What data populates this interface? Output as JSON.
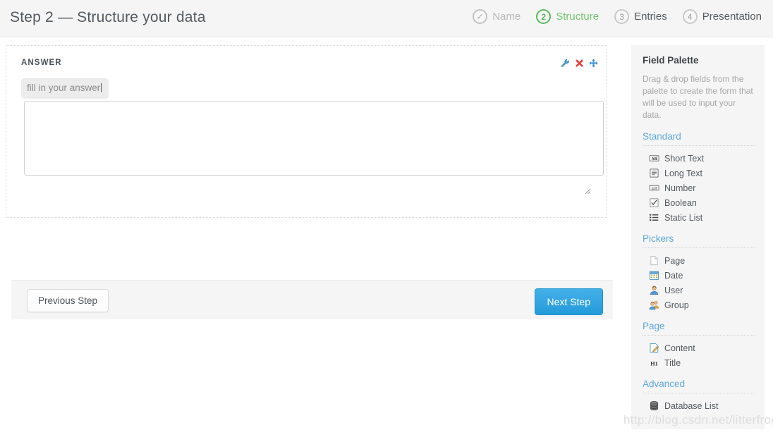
{
  "header": {
    "title": "Step 2 — Structure your data",
    "steps": [
      {
        "marker": "✓",
        "label": "Name",
        "state": "done"
      },
      {
        "marker": "2",
        "label": "Structure",
        "state": "active"
      },
      {
        "marker": "3",
        "label": "Entries",
        "state": "todo"
      },
      {
        "marker": "4",
        "label": "Presentation",
        "state": "todo"
      }
    ]
  },
  "form": {
    "field": {
      "label": "ANSWER",
      "input_value": "fill in your answer",
      "textarea_value": "",
      "textarea_placeholder": "",
      "actions": [
        {
          "icon": "wrench-icon",
          "title": "Configure"
        },
        {
          "icon": "delete-x-icon",
          "title": "Delete"
        },
        {
          "icon": "move-icon",
          "title": "Move"
        }
      ]
    },
    "footer": {
      "previous_label": "Previous Step",
      "next_label": "Next Step"
    }
  },
  "palette": {
    "title": "Field Palette",
    "description": "Drag & drop fields from the palette to create the form that will be used to input your data.",
    "groups": [
      {
        "name": "Standard",
        "items": [
          {
            "label": "Short Text",
            "icon": "short-text-icon"
          },
          {
            "label": "Long Text",
            "icon": "long-text-icon"
          },
          {
            "label": "Number",
            "icon": "number-icon"
          },
          {
            "label": "Boolean",
            "icon": "boolean-checkbox-icon"
          },
          {
            "label": "Static List",
            "icon": "static-list-icon"
          }
        ]
      },
      {
        "name": "Pickers",
        "items": [
          {
            "label": "Page",
            "icon": "page-document-icon"
          },
          {
            "label": "Date",
            "icon": "calendar-icon"
          },
          {
            "label": "User",
            "icon": "user-icon"
          },
          {
            "label": "Group",
            "icon": "group-users-icon"
          }
        ]
      },
      {
        "name": "Page",
        "items": [
          {
            "label": "Content",
            "icon": "content-edit-icon"
          },
          {
            "label": "Title",
            "icon": "heading-h1-icon"
          }
        ]
      },
      {
        "name": "Advanced",
        "items": [
          {
            "label": "Database List",
            "icon": "database-icon"
          }
        ]
      }
    ]
  },
  "watermark": "http://blog.csdn.net/litterfrog",
  "colors": {
    "accent_blue": "#239ada",
    "active_green": "#5cb85c",
    "link_blue": "#5fa8dd",
    "panel_gray": "#f5f5f5"
  }
}
